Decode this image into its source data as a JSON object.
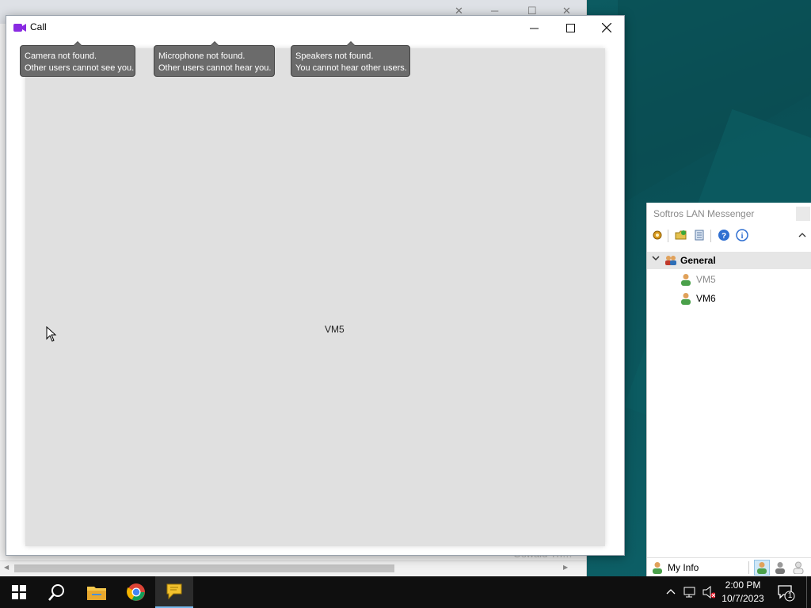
{
  "call_window": {
    "title": "Call",
    "controls": {
      "minimize": "minimize",
      "maximize": "maximize",
      "close": "close"
    },
    "participant_name": "VM5",
    "notices": [
      {
        "line1": "Camera not found.",
        "line2": "Other users cannot see you."
      },
      {
        "line1": "Microphone not found.",
        "line2": "Other users cannot hear you."
      },
      {
        "line1": "Speakers not found.",
        "line2": "You cannot hear other users."
      }
    ]
  },
  "background_window": {
    "footer_text": "Oswald Th…"
  },
  "messenger": {
    "title": "Softros LAN Messenger",
    "toolbar": [
      "settings-icon",
      "folder-icon",
      "history-icon",
      "help-icon",
      "info-icon",
      "collapse-icon"
    ],
    "group": {
      "name": "General",
      "expanded": true
    },
    "users": [
      {
        "name": "VM5",
        "status": "offline"
      },
      {
        "name": "VM6",
        "status": "online"
      }
    ],
    "bottom": {
      "my_info_label": "My Info",
      "current_status": "online"
    }
  },
  "taskbar": {
    "apps": [
      "start-icon",
      "search-icon",
      "file-explorer-icon",
      "chrome-icon",
      "softros-messenger-icon"
    ],
    "active_app": "softros-messenger-icon",
    "clock_time": "2:00 PM",
    "clock_date": "10/7/2023",
    "notification_count": "1"
  },
  "colors": {
    "tooltip_bg": "#6b6b6b",
    "video_bg": "#e0e0e0",
    "taskbar_bg": "#0f0f0f",
    "accent": "#76b9ed"
  }
}
